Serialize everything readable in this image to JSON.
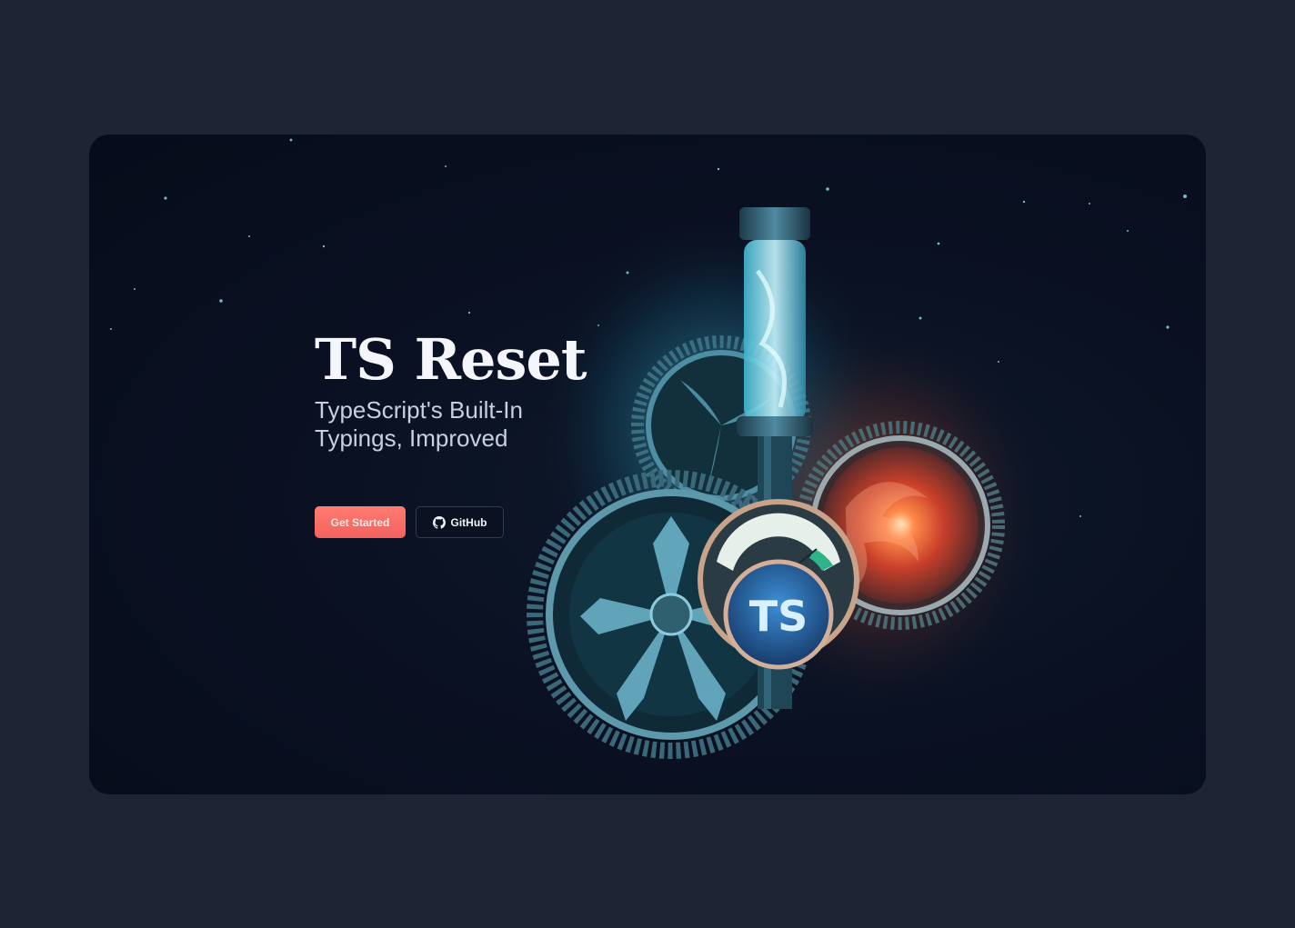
{
  "hero": {
    "title": "TS Reset",
    "subtitle": "TypeScript's Built-In Typings, Improved",
    "buttons": {
      "primary_label": "Get Started",
      "secondary_label": "GitHub",
      "secondary_icon": "github-icon"
    },
    "art": {
      "badge_text": "TS",
      "description_icon": "clockwork-gears-illustration"
    }
  },
  "colors": {
    "page_background": "#1e2433",
    "card_background": "#0a1122",
    "primary_button": "#f36a63",
    "title_text": "#f4f6fb",
    "subtitle_text": "#c7cfe0",
    "glow_cyan": "#7fe6ff",
    "glow_orange": "#ff6a3d",
    "badge_blue": "#3b9ee8"
  }
}
